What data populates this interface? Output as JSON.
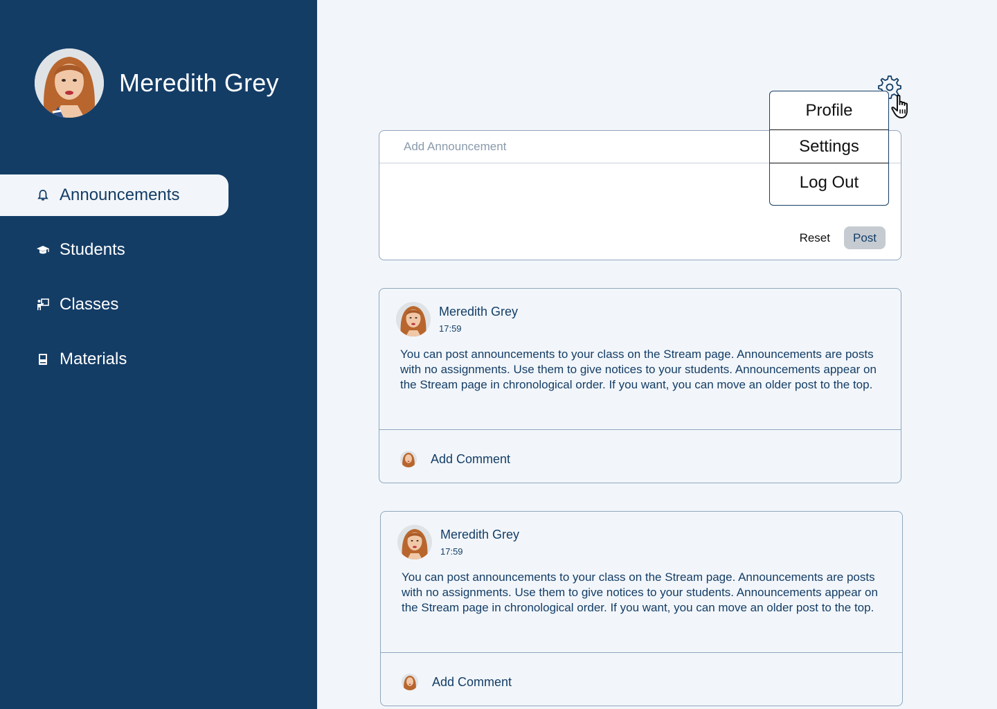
{
  "user": {
    "name": "Meredith Grey"
  },
  "sidebar": {
    "items": [
      {
        "label": "Announcements",
        "icon": "bell-icon",
        "active": true
      },
      {
        "label": "Students",
        "icon": "graduation-cap-icon",
        "active": false
      },
      {
        "label": "Classes",
        "icon": "classroom-icon",
        "active": false
      },
      {
        "label": "Materials",
        "icon": "book-icon",
        "active": false
      }
    ]
  },
  "settings_menu": {
    "icon": "gear-icon",
    "items": [
      "Profile",
      "Settings",
      "Log Out"
    ]
  },
  "composer": {
    "placeholder": "Add Announcement",
    "reset_label": "Reset",
    "post_label": "Post"
  },
  "posts": [
    {
      "author": "Meredith Grey",
      "time": "17:59",
      "body": "You can post announcements to your class on the Stream page. Announcements are posts with no assignments. Use them to give notices to your students. Announcements appear on the Stream page in chronological order. If you want, you can move an older post to the top.",
      "comment_label": "Add Comment"
    },
    {
      "author": "Meredith Grey",
      "time": "17:59",
      "body": "You can post announcements to your class on the Stream page. Announcements are posts with no assignments. Use them to give notices to your students. Announcements appear on the Stream page in chronological order. If you want, you can move an older post to the top.",
      "comment_label": "Add Comment"
    }
  ],
  "colors": {
    "sidebar_bg": "#143d66",
    "page_bg": "#f2f6fa",
    "accent": "#143d66",
    "border": "#8fa6bd",
    "post_button_bg": "#c5cbd1"
  }
}
